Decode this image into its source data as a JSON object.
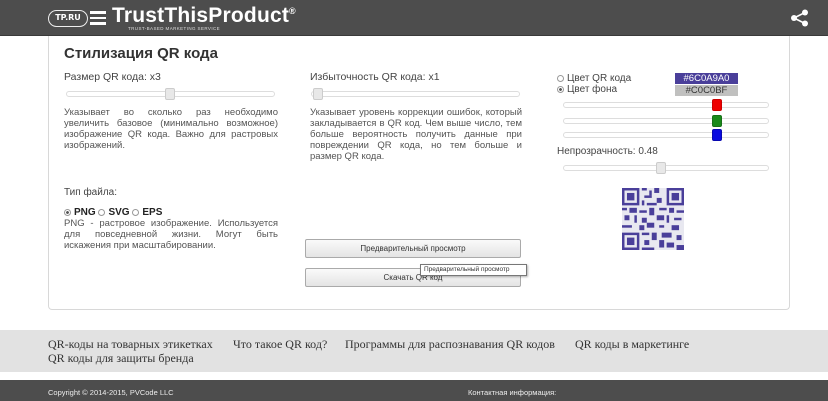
{
  "header": {
    "logo_badge": "TP.RU",
    "brand_name": "TrustThisProduct",
    "brand_mark": "®",
    "tagline": "TRUST-BASED MARKETING SERVICE",
    "icons": [
      "menu-icon",
      "share-icon"
    ]
  },
  "main": {
    "title": "Стилизация QR кода",
    "size": {
      "label": "Размер QR кода: x3",
      "description": "Указывает во сколько раз необходимо увеличить базовое (минимально возможное) изображение QR кода. Важно для растровых изображений.",
      "level": 3
    },
    "redundancy": {
      "label": "Избыточность QR кода: x1",
      "description": "Указывает уровень коррекции ошибок, который закладывается в QR код. Чем выше число, тем больше вероятность получить данные при повреждении QR кода, но тем больше и размер QR кода.",
      "level": 1
    },
    "color": {
      "option_qr": "Цвет QR кода",
      "option_bg": "Цвет фона",
      "selected": "Цвет фона",
      "qr_hex": "#6C0A9A0",
      "bg_hex": "#C0C0BF",
      "qr_swatch_color": "#4a3f9a",
      "bg_swatch_color": "#c0c0bf"
    },
    "opacity": {
      "label": "Непрозрачность: 0.48",
      "value": 0.48
    },
    "filetype": {
      "label": "Тип файла:",
      "options": [
        "PNG",
        "SVG",
        "EPS"
      ],
      "selected": "PNG",
      "description": "PNG - растровое изображение. Используется для повседневной жизни. Могут быть искажения при масштабировании."
    },
    "buttons": {
      "preview": "Предварительный просмотр",
      "download": "Скачать QR код"
    },
    "tooltip": "Предварительный просмотр"
  },
  "links": [
    "QR-коды на товарных этикетках",
    "Что такое QR код?",
    "Программы для распознавания QR кодов",
    "QR коды в маркетинге",
    "QR коды для защиты бренда"
  ],
  "footer": {
    "copyright": "Copyright © 2014-2015, PVCode LLC",
    "contacts": "Контактная информация:"
  }
}
